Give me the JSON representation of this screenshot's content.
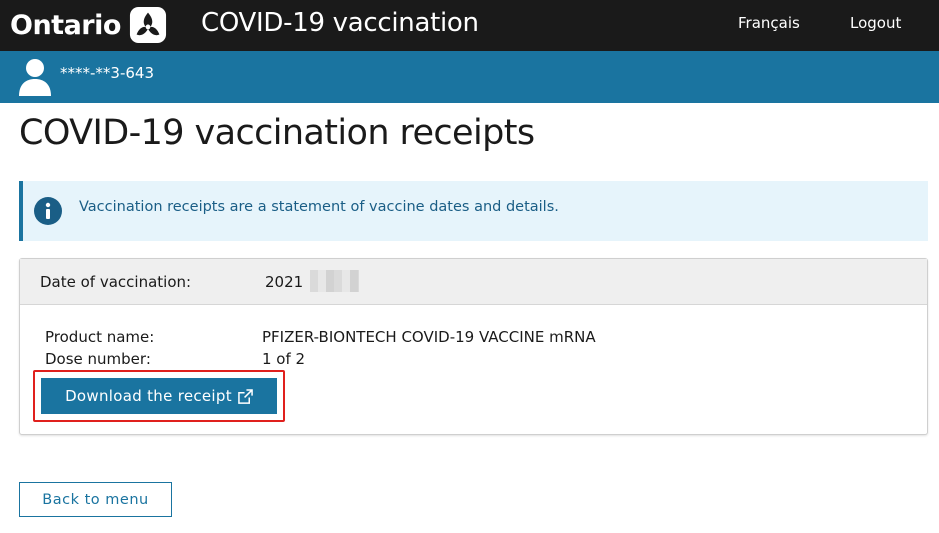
{
  "header": {
    "logo_text": "Ontario",
    "app_title": "COVID-19 vaccination",
    "language_link": "Français",
    "logout_link": "Logout"
  },
  "user": {
    "health_card_masked": "****-**3-643"
  },
  "page": {
    "title": "COVID-19 vaccination receipts"
  },
  "info": {
    "message": "Vaccination receipts are a statement of vaccine dates and details."
  },
  "receipt": {
    "date_label": "Date of vaccination:",
    "date_value": "2021",
    "product_label": "Product name:",
    "product_value": "PFIZER-BIONTECH COVID-19 VACCINE mRNA",
    "dose_label": "Dose number:",
    "dose_value": "1 of 2",
    "download_label": "Download the receipt"
  },
  "footer": {
    "back_label": "Back to menu"
  },
  "colors": {
    "header_bg": "#1a1a1a",
    "user_bar_bg": "#1a74a0",
    "info_bg": "#e6f4fb",
    "primary": "#1a74a0",
    "highlight": "#e0201d"
  },
  "icons": {
    "logo": "ontario-trillium-icon",
    "user": "user-icon",
    "info": "info-icon",
    "external": "external-link-icon"
  }
}
